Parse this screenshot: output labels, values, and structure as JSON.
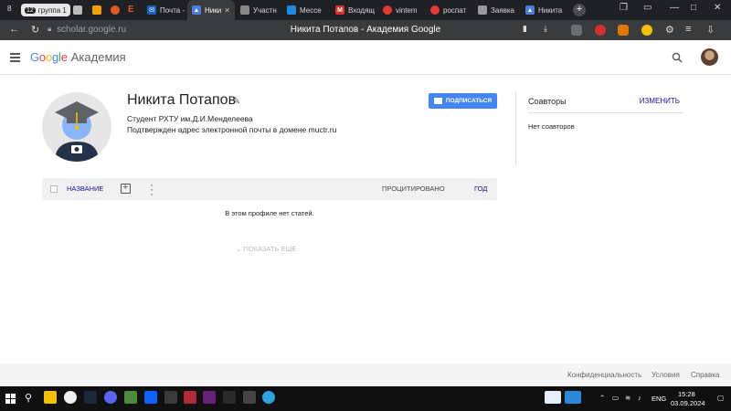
{
  "browser": {
    "tab_count": "8",
    "tab_group": {
      "count": "12",
      "label": "группа 1"
    },
    "tabs": [
      {
        "label": "Почта -",
        "color": "#1565c0",
        "icon": "mail-icon"
      },
      {
        "label": "Ники",
        "color": "#4a7fd9",
        "icon": "scholar-icon",
        "active": true
      },
      {
        "label": "Участн",
        "color": "#888888",
        "icon": "doc-icon"
      },
      {
        "label": "Мессе",
        "color": "#1e88e5",
        "icon": "messenger-icon"
      },
      {
        "label": "Входящ",
        "color": "#d93025",
        "icon": "gmail-icon"
      },
      {
        "label": "vintem",
        "color": "#e53935",
        "icon": "vintem-icon"
      },
      {
        "label": "роспат",
        "color": "#e53935",
        "icon": "rospat-icon"
      },
      {
        "label": "Заявка",
        "color": "#999999",
        "icon": "rospatent-icon"
      },
      {
        "label": "Никита",
        "color": "#4a7fd9",
        "icon": "scholar-icon"
      }
    ],
    "url": "scholar.google.ru",
    "page_title": "Никита Потапов - Академия Google"
  },
  "app": {
    "logo_text": "Google",
    "logo_suffix": "Академия",
    "logo_colors": [
      "#4285f4",
      "#ea4335",
      "#fbbc05",
      "#4285f4",
      "#34a853",
      "#ea4335"
    ]
  },
  "profile": {
    "name": "Никита Потапов",
    "affiliation": "Студент РХТУ им.Д.И.Менделеева",
    "verified": "Подтвержден адрес электронной почты в домене muctr.ru",
    "subscribe_label": "ПОДПИСАТЬСЯ"
  },
  "coauthors": {
    "title": "Соавторы",
    "edit_label": "ИЗМЕНИТЬ",
    "empty": "Нет соавторов"
  },
  "articles": {
    "col_title": "НАЗВАНИЕ",
    "col_cited": "ПРОЦИТИРОВАНО",
    "col_year": "ГОД",
    "empty": "В этом профиле нет статей.",
    "show_more": "ПОКАЗАТЬ ЕЩЁ"
  },
  "footer": {
    "privacy": "Конфиденциальность",
    "terms": "Условия",
    "help": "Справка"
  },
  "taskbar": {
    "lang": "ENG",
    "time": "15:28",
    "date": "03.09.2024"
  }
}
